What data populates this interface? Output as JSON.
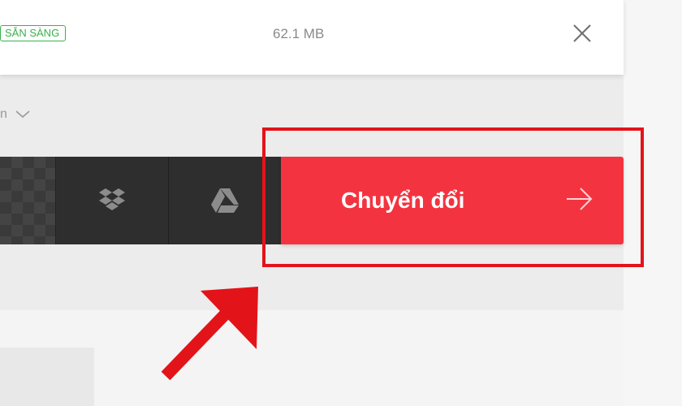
{
  "file": {
    "status": "SẴN SÀNG",
    "size": "62.1 MB",
    "close_icon": "close-icon"
  },
  "options": {
    "partial_text": "n",
    "chevron_icon": "chevron-down-icon"
  },
  "action_bar": {
    "device_icon": "device-upload-segment",
    "dropbox_icon": "dropbox-icon",
    "gdrive_icon": "google-drive-icon",
    "convert_label": "Chuyển đổi",
    "convert_arrow_icon": "arrow-right-icon"
  },
  "annotation": {
    "highlight_icon": "highlight-box",
    "pointer_icon": "pointer-arrow-icon"
  },
  "colors": {
    "status_green": "#38b24b",
    "convert_red": "#f33440",
    "highlight_red": "#e3131a",
    "bar_dark": "#2f2f2f"
  }
}
